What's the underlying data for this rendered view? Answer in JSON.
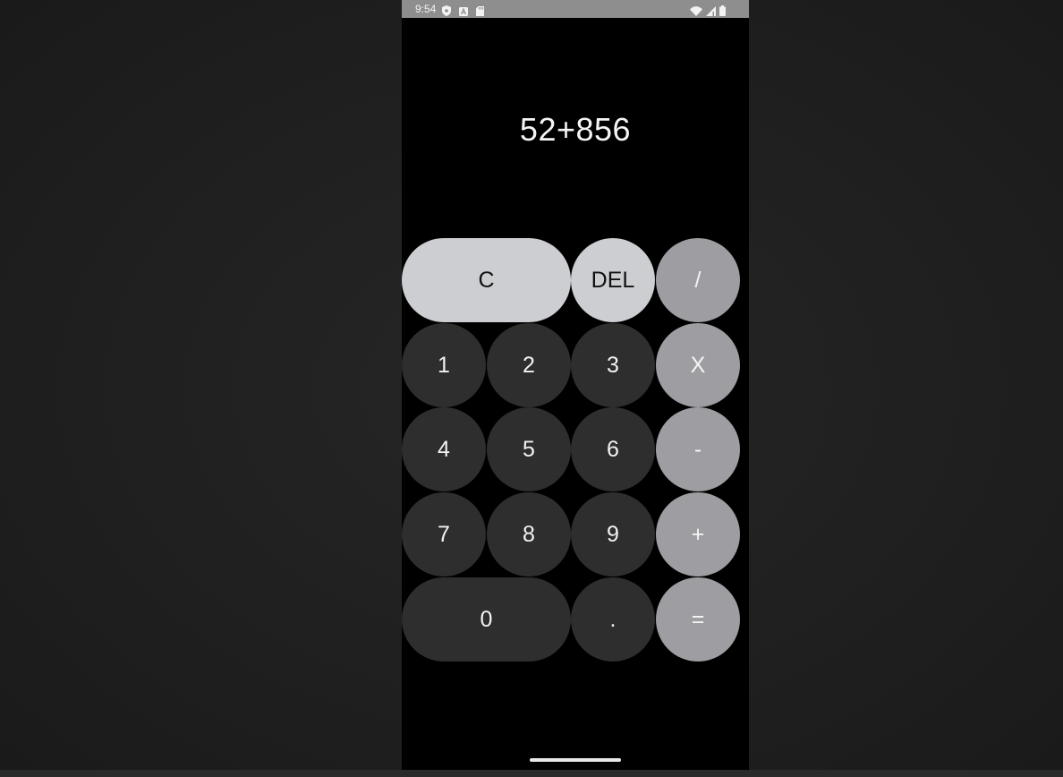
{
  "status_bar": {
    "time": "9:54",
    "left_icons": [
      "shield-icon",
      "a-badge-icon",
      "sd-card-icon"
    ],
    "right_icons": [
      "wifi-icon",
      "cellular-signal-icon",
      "battery-icon"
    ]
  },
  "display": {
    "expression": "52+856"
  },
  "keys": {
    "clear": "C",
    "delete": "DEL",
    "divide": "/",
    "one": "1",
    "two": "2",
    "three": "3",
    "multiply": "X",
    "four": "4",
    "five": "5",
    "six": "6",
    "minus": "-",
    "seven": "7",
    "eight": "8",
    "nine": "9",
    "plus": "+",
    "zero": "0",
    "decimal": ".",
    "equals": "="
  },
  "colors": {
    "number_key": "#2e2e2e",
    "function_key": "#cdced2",
    "operator_key": "#9e9ea2",
    "screen_background": "#000000"
  }
}
